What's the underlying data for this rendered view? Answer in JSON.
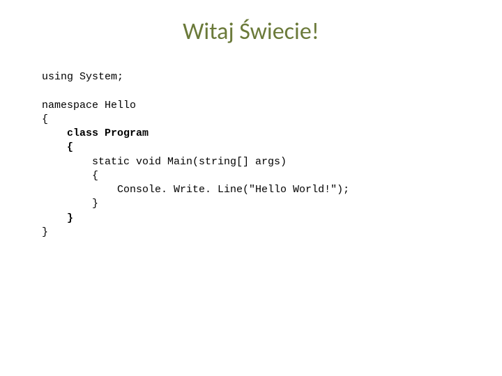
{
  "title": "Witaj Świecie!",
  "code": {
    "line1": "using System;",
    "line2": "",
    "line3": "namespace Hello",
    "line4": "{",
    "line5": "    class Program",
    "line6": "    {",
    "line7": "        static void Main(string[] args)",
    "line8": "        {",
    "line9": "            Console. Write. Line(\"Hello World!\");",
    "line10": "        }",
    "line11": "    }",
    "line12": "}"
  }
}
